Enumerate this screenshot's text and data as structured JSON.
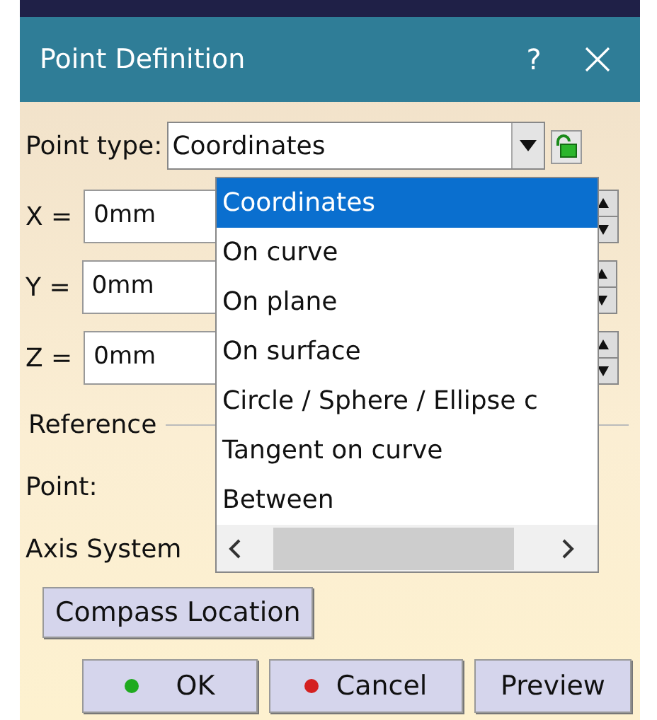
{
  "window": {
    "title": "Point Definition",
    "help": "?"
  },
  "point_type": {
    "label": "Point type:",
    "value": "Coordinates"
  },
  "coordinates": [
    {
      "label": "X =",
      "value": "0mm"
    },
    {
      "label": "Y =",
      "value": "0mm"
    },
    {
      "label": "Z =",
      "value": "0mm"
    }
  ],
  "reference": {
    "label": "Reference",
    "point_label": "Point:",
    "axis_label": "Axis System"
  },
  "dropdown": {
    "expanded": true,
    "items": [
      {
        "label": "Coordinates",
        "selected": true
      },
      {
        "label": "On curve",
        "selected": false
      },
      {
        "label": "On plane",
        "selected": false
      },
      {
        "label": "On surface",
        "selected": false
      },
      {
        "label": "Circle / Sphere / Ellipse c",
        "selected": false
      },
      {
        "label": "Tangent on curve",
        "selected": false
      },
      {
        "label": "Between",
        "selected": false
      }
    ]
  },
  "compass_button": "Compass Location",
  "buttons": [
    {
      "label": "OK",
      "kind": "ok"
    },
    {
      "label": "Cancel",
      "kind": "cancel"
    },
    {
      "label": "Preview",
      "kind": "plain"
    }
  ]
}
